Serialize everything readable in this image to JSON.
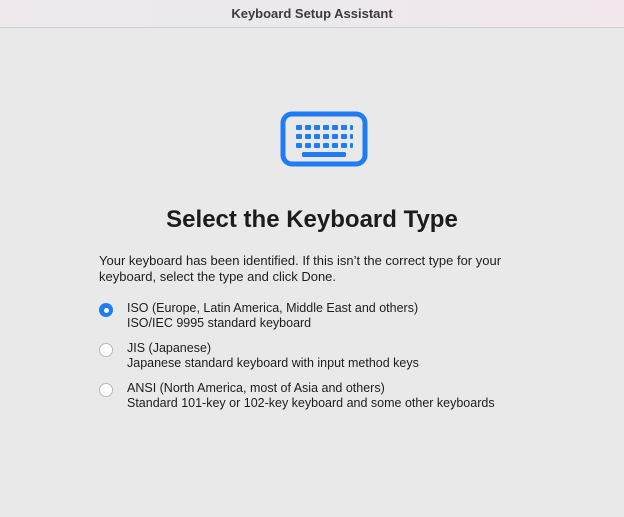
{
  "window": {
    "title": "Keyboard Setup Assistant"
  },
  "hero": {
    "icon": "keyboard-icon",
    "accent_color": "#1f7cf2"
  },
  "heading": "Select the Keyboard Type",
  "description": "Your keyboard has been identified. If this isn’t the correct type for your keyboard, select the type and click Done.",
  "options": [
    {
      "label": "ISO (Europe, Latin America, Middle East and others)",
      "detail": "ISO/IEC 9995 standard keyboard",
      "selected": true
    },
    {
      "label": "JIS (Japanese)",
      "detail": "Japanese standard keyboard with input method keys",
      "selected": false
    },
    {
      "label": "ANSI (North America, most of Asia and others)",
      "detail": "Standard 101-key or 102-key keyboard and some other keyboards",
      "selected": false
    }
  ]
}
